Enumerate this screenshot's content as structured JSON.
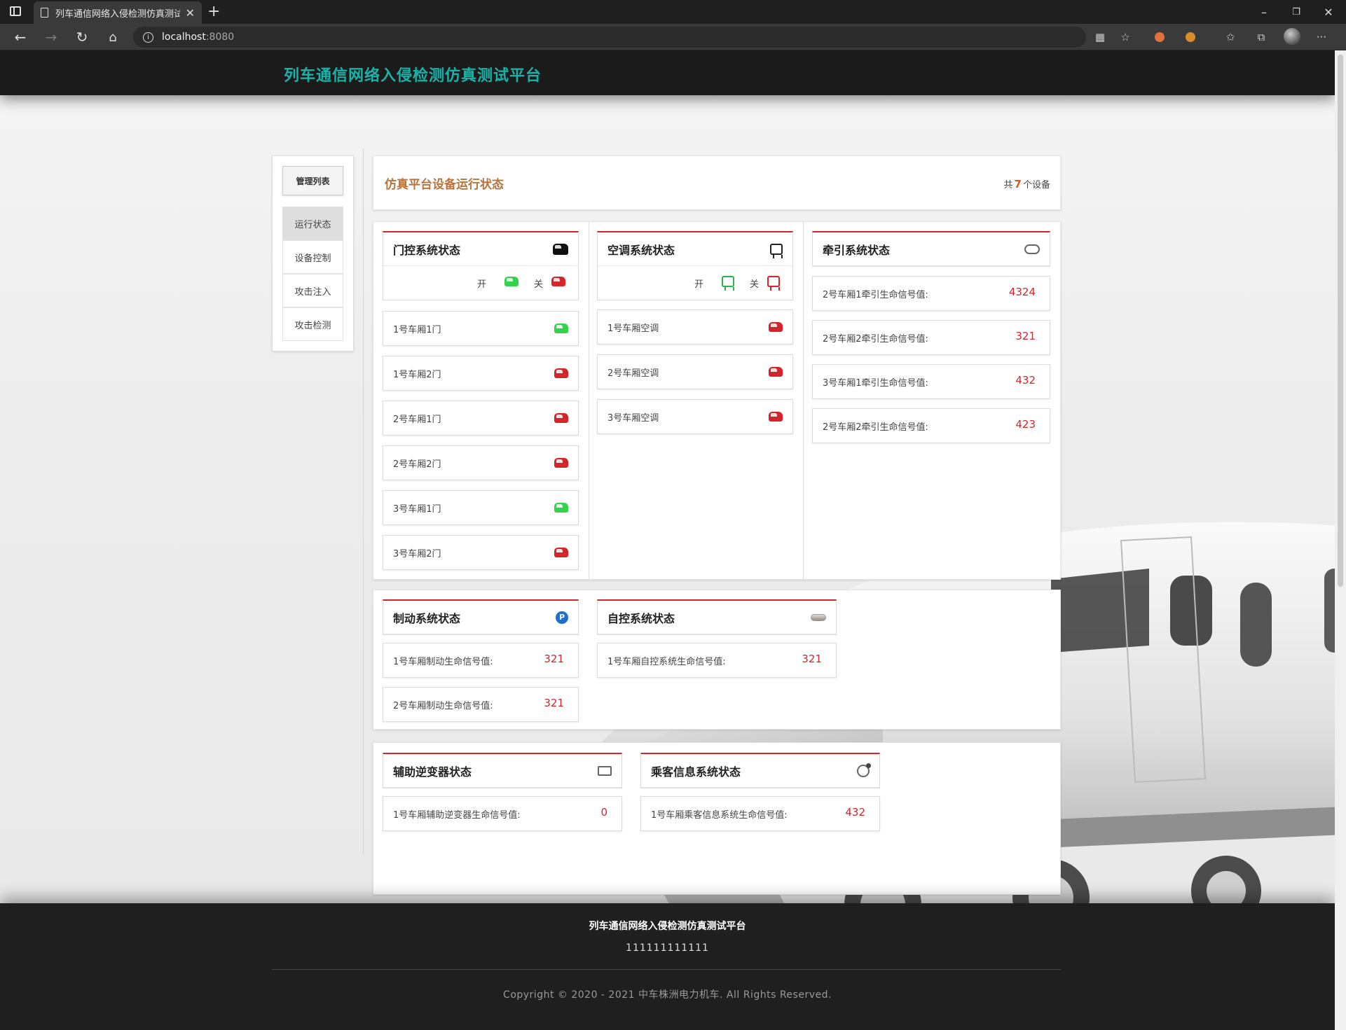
{
  "browser": {
    "tab_title": "列车通信网络入侵检测仿真测试",
    "url_host": "localhost",
    "url_port": ":8080"
  },
  "header": {
    "title": "列车通信网络入侵检测仿真测试平台"
  },
  "sidebar": {
    "heading": "管理列表",
    "items": [
      {
        "label": "运行状态",
        "active": true
      },
      {
        "label": "设备控制"
      },
      {
        "label": "攻击注入"
      },
      {
        "label": "攻击检测"
      }
    ]
  },
  "status": {
    "title": "仿真平台设备运行状态",
    "count_prefix": "共",
    "count": "7",
    "count_suffix": "个设备"
  },
  "legend": {
    "open": "开",
    "close": "关"
  },
  "door_system": {
    "title": "门控系统状态",
    "icon": "car-door-icon",
    "items": [
      {
        "label": "1号车厢1门",
        "state": "open"
      },
      {
        "label": "1号车厢2门",
        "state": "closed"
      },
      {
        "label": "2号车厢1门",
        "state": "closed"
      },
      {
        "label": "2号车厢2门",
        "state": "closed"
      },
      {
        "label": "3号车厢1门",
        "state": "open"
      },
      {
        "label": "3号车厢2门",
        "state": "closed"
      }
    ]
  },
  "ac_system": {
    "title": "空调系统状态",
    "icon": "air-conditioner-icon",
    "items": [
      {
        "label": "1号车厢空调",
        "state": "closed"
      },
      {
        "label": "2号车厢空调",
        "state": "closed"
      },
      {
        "label": "3号车厢空调",
        "state": "closed"
      }
    ]
  },
  "traction_system": {
    "title": "牵引系统状态",
    "icon": "traction-icon",
    "items": [
      {
        "label": "2号车厢1牵引生命信号值:",
        "value": "4324"
      },
      {
        "label": "2号车厢2牵引生命信号值:",
        "value": "321"
      },
      {
        "label": "3号车厢1牵引生命信号值:",
        "value": "432"
      },
      {
        "label": "2号车厢2牵引生命信号值:",
        "value": "423"
      }
    ]
  },
  "brake_system": {
    "title": "制动系统状态",
    "icon": "parking-brake-icon",
    "items": [
      {
        "label": "1号车厢制动生命信号值:",
        "value": "321"
      },
      {
        "label": "2号车厢制动生命信号值:",
        "value": "321"
      }
    ]
  },
  "auto_system": {
    "title": "自控系统状态",
    "icon": "train-icon",
    "items": [
      {
        "label": "1号车厢自控系统生命信号值:",
        "value": "321"
      }
    ]
  },
  "inverter_system": {
    "title": "辅助逆变器状态",
    "icon": "battery-icon",
    "items": [
      {
        "label": "1号车厢辅助逆变器生命信号值:",
        "value": "0"
      }
    ]
  },
  "pis_system": {
    "title": "乘客信息系统状态",
    "icon": "globe-icon",
    "items": [
      {
        "label": "1号车厢乘客信息系统生命信号值:",
        "value": "432"
      }
    ]
  },
  "footer": {
    "title": "列车通信网络入侵检测仿真测试平台",
    "subtitle": "111111111111",
    "copyright": "Copyright © 2020 - 2021 中车株洲电力机车. All Rights Reserved."
  },
  "colors": {
    "brand_teal": "#19b2a8",
    "accent_red": "#d0262c",
    "title_brown": "#b5753d",
    "open_green": "#34d34b",
    "closed_red": "#d3252a"
  }
}
